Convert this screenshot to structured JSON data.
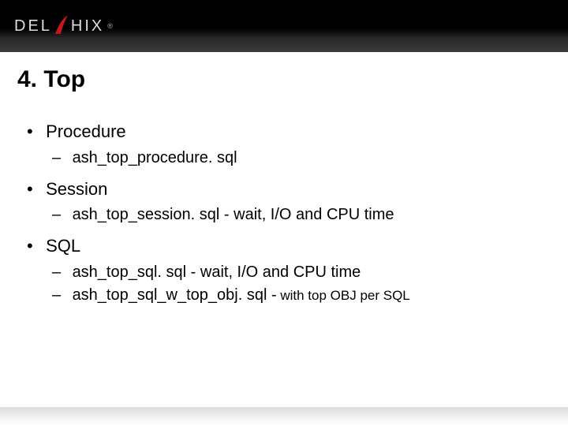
{
  "brand": {
    "name_left": "DEL",
    "name_right": "HIX",
    "registered": "®"
  },
  "title": "4. Top",
  "bullets": [
    {
      "label": "Procedure",
      "subs": [
        {
          "text": "ash_top_procedure. sql"
        }
      ]
    },
    {
      "label": "Session",
      "subs": [
        {
          "text": "ash_top_session. sql - wait, I/O and CPU time"
        }
      ]
    },
    {
      "label": "SQL",
      "subs": [
        {
          "text": "ash_top_sql. sql - wait, I/O and CPU time"
        },
        {
          "text": "ash_top_sql_w_top_obj. sql  -",
          "note": " with top OBJ per SQL"
        }
      ]
    }
  ]
}
